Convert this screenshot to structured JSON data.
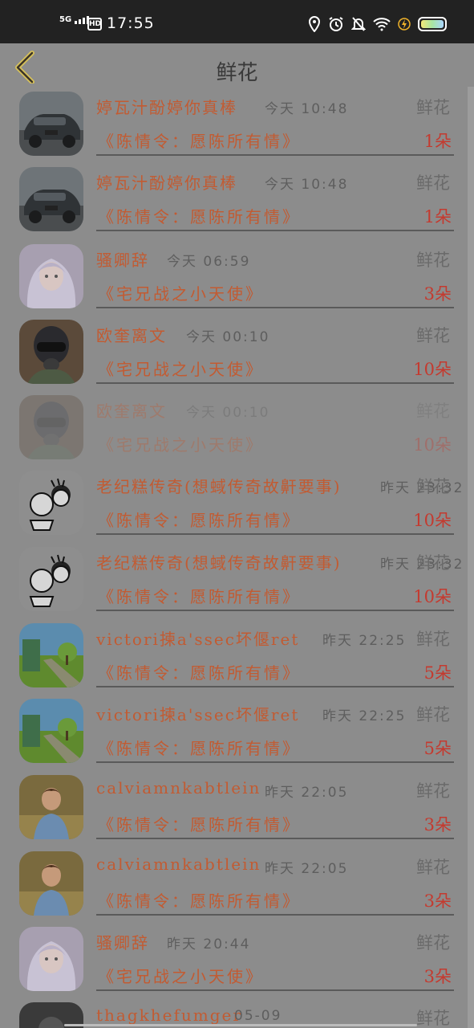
{
  "status_bar": {
    "network": "5G",
    "hd": "HD",
    "time": "17:55",
    "icons": [
      "location-icon",
      "alarm-icon",
      "mute-bell-icon",
      "wifi-icon",
      "charging-icon",
      "battery-icon"
    ]
  },
  "header": {
    "title": "鲜花",
    "back_icon": "chevron-left-icon"
  },
  "colors": {
    "name": "#c25b32",
    "count": "#c43a2f",
    "overlay": "#8c8c8c"
  },
  "records": [
    {
      "name": "婷瓦汁酚婷你真棒",
      "time": "今天 10:48",
      "gift": "鲜花",
      "drama": "《陈情令：愿陈所有情》",
      "count": "1朵",
      "avatar": "car"
    },
    {
      "name": "婷瓦汁酚婷你真棒",
      "time": "今天 10:48",
      "gift": "鲜花",
      "drama": "《陈情令：愿陈所有情》",
      "count": "1朵",
      "avatar": "car"
    },
    {
      "name": "骚卿辞",
      "time": "今天 06:59",
      "gift": "鲜花",
      "drama": "《宅兄战之小天使》",
      "count": "3朵",
      "avatar": "anime"
    },
    {
      "name": "欧奎离文",
      "time": "今天 00:10",
      "gift": "鲜花",
      "drama": "《宅兄战之小天使》",
      "count": "10朵",
      "avatar": "pilot"
    },
    {
      "name": "欧奎离文",
      "time": "今天 00:10",
      "gift": "鲜花",
      "drama": "《宅兄战之小天使》",
      "count": "10朵",
      "avatar": "pilot"
    },
    {
      "name": "老纪糕传奇(想蜮传奇故鼾要事)",
      "time": "昨天 23:32",
      "gift": "鲜花",
      "drama": "《陈情令：愿陈所有情》",
      "count": "10朵",
      "avatar": "cartoon"
    },
    {
      "name": "老纪糕传奇(想蜮传奇故鼾要事)",
      "time": "昨天 23:32",
      "gift": "鲜花",
      "drama": "《陈情令：愿陈所有情》",
      "count": "10朵",
      "avatar": "cartoon"
    },
    {
      "name": "victori揀a'ssec坏偃ret",
      "time": "昨天 22:25",
      "gift": "鲜花",
      "drama": "《陈情令：愿陈所有情》",
      "count": "5朵",
      "avatar": "park"
    },
    {
      "name": "victori揀a'ssec坏偃ret",
      "time": "昨天 22:25",
      "gift": "鲜花",
      "drama": "《陈情令：愿陈所有情》",
      "count": "5朵",
      "avatar": "park"
    },
    {
      "name": "calviamnkabtlein",
      "time": "昨天 22:05",
      "gift": "鲜花",
      "drama": "《陈情令：愿陈所有情》",
      "count": "3朵",
      "avatar": "boy"
    },
    {
      "name": "calviamnkabtlein",
      "time": "昨天 22:05",
      "gift": "鲜花",
      "drama": "《陈情令：愿陈所有情》",
      "count": "3朵",
      "avatar": "boy"
    },
    {
      "name": "骚卿辞",
      "time": "昨天 20:44",
      "gift": "鲜花",
      "drama": "《宅兄战之小天使》",
      "count": "3朵",
      "avatar": "anime"
    },
    {
      "name": "thagkhefumger",
      "time": "05-09",
      "gift": "鲜花",
      "drama": "",
      "count": "",
      "avatar": "dark"
    }
  ]
}
